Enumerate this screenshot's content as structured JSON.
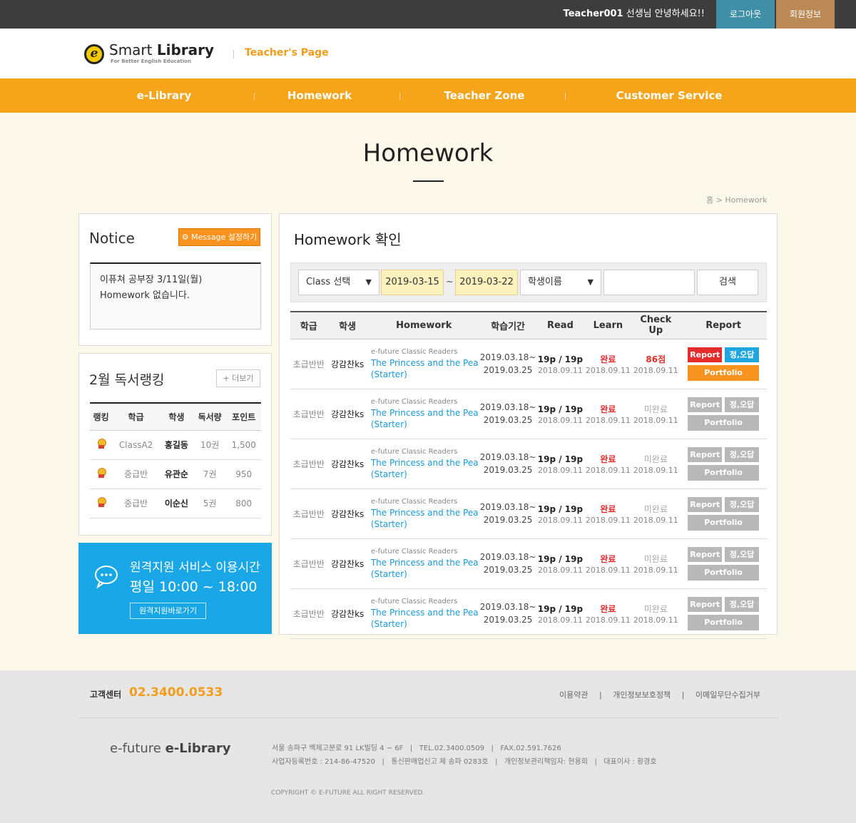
{
  "topbar": {
    "user": "Teacher001",
    "greeting_suffix": "선생님 안녕하세요!!",
    "logout_label": "로그아웃",
    "member_label": "회원정보"
  },
  "header": {
    "logo_text_regular": "Smart",
    "logo_text_bold": "Library",
    "logo_sub": "For Better English Education",
    "page_label": "Teacher's Page"
  },
  "nav": [
    "e-Library",
    "Homework",
    "Teacher Zone",
    "Customer Service"
  ],
  "page_title": "Homework",
  "breadcrumb": {
    "home": "홈",
    "sep": ">",
    "current": "Homework"
  },
  "notice": {
    "title": "Notice",
    "message_button": "Message 설정하기",
    "body_line1": "이퓨쳐 공부장 3/11일(월)",
    "body_line2": "Homework 없습니다."
  },
  "ranking": {
    "title": "2월 독서랭킹",
    "more_label": "+ 더보기",
    "headers": [
      "랭킹",
      "학급",
      "학생",
      "독서량",
      "포인트"
    ],
    "rows": [
      {
        "level": "ClassA2",
        "name": "홍길동",
        "books": "10권",
        "points": "1,500"
      },
      {
        "level": "중급반",
        "name": "유관순",
        "books": "7권",
        "points": "950"
      },
      {
        "level": "중급반",
        "name": "이순신",
        "books": "5권",
        "points": "800"
      }
    ]
  },
  "support": {
    "line1": "원격지원 서비스 이용시간",
    "line2": "평일 10:00 ~ 18:00",
    "button": "원격지원바로가기"
  },
  "homework": {
    "title": "Homework 확인",
    "filter": {
      "class_select": "Class 선택",
      "date_from": "2019-03-15",
      "tilde": "~",
      "date_to": "2019-03-22",
      "student_select": "학생이름",
      "search_value": "",
      "search_button": "검색"
    },
    "headers": [
      "학급",
      "학생",
      "Homework",
      "학습기간",
      "Read",
      "Learn",
      "Check Up",
      "Report"
    ],
    "report_label": "Report",
    "wrong_label": "정,오답",
    "portfolio_label": "Portfolio",
    "rows": [
      {
        "level": "초급반반",
        "student": "강감찬ks",
        "series": "e-future Classic Readers",
        "book": "The Princess and the Pea (Starter)",
        "period_from": "2019.03.18~",
        "period_to": "2019.03.25",
        "read": "19p / 19p",
        "read_date": "2018.09.11",
        "learn": "완료",
        "learn_date": "2018.09.11",
        "checkup": "86점",
        "checkup_date": "2018.09.11",
        "active": true
      },
      {
        "level": "초급반반",
        "student": "강감찬ks",
        "series": "e-future Classic Readers",
        "book": "The Princess and the Pea (Starter)",
        "period_from": "2019.03.18~",
        "period_to": "2019.03.25",
        "read": "19p / 19p",
        "read_date": "2018.09.11",
        "learn": "완료",
        "learn_date": "2018.09.11",
        "checkup": "미완료",
        "checkup_date": "2018.09.11",
        "active": false
      },
      {
        "level": "초급반반",
        "student": "강감찬ks",
        "series": "e-future Classic Readers",
        "book": "The Princess and the Pea (Starter)",
        "period_from": "2019.03.18~",
        "period_to": "2019.03.25",
        "read": "19p / 19p",
        "read_date": "2018.09.11",
        "learn": "완료",
        "learn_date": "2018.09.11",
        "checkup": "미완료",
        "checkup_date": "2018.09.11",
        "active": false
      },
      {
        "level": "초급반반",
        "student": "강감찬ks",
        "series": "e-future Classic Readers",
        "book": "The Princess and the Pea (Starter)",
        "period_from": "2019.03.18~",
        "period_to": "2019.03.25",
        "read": "19p / 19p",
        "read_date": "2018.09.11",
        "learn": "완료",
        "learn_date": "2018.09.11",
        "checkup": "미완료",
        "checkup_date": "2018.09.11",
        "active": false
      },
      {
        "level": "초급반반",
        "student": "강감찬ks",
        "series": "e-future Classic Readers",
        "book": "The Princess and the Pea (Starter)",
        "period_from": "2019.03.18~",
        "period_to": "2019.03.25",
        "read": "19p / 19p",
        "read_date": "2018.09.11",
        "learn": "완료",
        "learn_date": "2018.09.11",
        "checkup": "미완료",
        "checkup_date": "2018.09.11",
        "active": false
      },
      {
        "level": "초급반반",
        "student": "강감찬ks",
        "series": "e-future Classic Readers",
        "book": "The Princess and the Pea (Starter)",
        "period_from": "2019.03.18~",
        "period_to": "2019.03.25",
        "read": "19p / 19p",
        "read_date": "2018.09.11",
        "learn": "완료",
        "learn_date": "2018.09.11",
        "checkup": "미완료",
        "checkup_date": "2018.09.11",
        "active": false
      }
    ]
  },
  "footer": {
    "cs_label": "고객센터",
    "cs_number": "02.3400.0533",
    "links": [
      "이용약관",
      "개인정보보호정책",
      "이메일무단수집거부"
    ],
    "logo_regular": "e-future",
    "logo_bold": "e-Library",
    "address_line1": "서울 송파구 백제고분로 91 LK빌딩 4 ~ 6F   |   TEL.02.3400.0509   |   FAX.02.591.7626",
    "address_line2": "사업자등록번호 : 214-86-47520   |   통신판매업신고 제 송파 0283호   |   개인정보관리책임자: 현용희   |   대표이사 : 황경호",
    "copyright": "COPYRIGHT © E-FUTURE ALL RIGHT RESERVED."
  },
  "colors": {
    "accent_orange": "#f6a51a",
    "support_blue": "#1aa7e8",
    "report_red": "#e52c2c",
    "wrong_blue": "#20a6df"
  }
}
